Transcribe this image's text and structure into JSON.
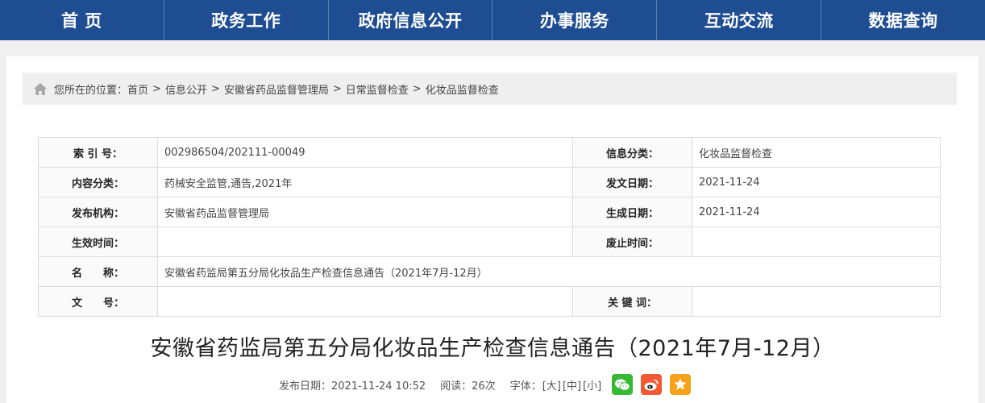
{
  "nav": {
    "items": [
      "首 页",
      "政务工作",
      "政府信息公开",
      "办事服务",
      "互动交流",
      "数据查询"
    ]
  },
  "breadcrumb": {
    "prefix": "您所在的位置：",
    "items": [
      "首页",
      "信息公开",
      "安徽省药品监督管理局",
      "日常监督检查",
      "化妆品监督检查"
    ],
    "separator": ">"
  },
  "meta": {
    "index_label": "索 引 号：",
    "index_value": "002986504/202111-00049",
    "category_label": "信息分类：",
    "category_value": "化妆品监督检查",
    "content_label": "内容分类：",
    "content_value": "药械安全监管,通告,2021年",
    "issue_date_label": "发文日期：",
    "issue_date_value": "2021-11-24",
    "org_label": "发布机构：",
    "org_value": "安徽省药品监督管理局",
    "gen_date_label": "生成日期：",
    "gen_date_value": "2021-11-24",
    "effective_label": "生效时间：",
    "effective_value": "",
    "abolish_label": "废止时间：",
    "abolish_value": "",
    "name_label": "名　　称：",
    "name_value": "安徽省药监局第五分局化妆品生产检查信息通告（2021年7月-12月）",
    "doc_no_label": "文　　号：",
    "doc_no_value": "",
    "keywords_label": "关 键 词：",
    "keywords_value": ""
  },
  "article": {
    "title": "安徽省药监局第五分局化妆品生产检查信息通告（2021年7月-12月）",
    "publish_prefix": "发布日期：2021-11-24 10:52",
    "reads": "阅读：26次",
    "font_label": "字体：",
    "font_large": "[大]",
    "font_medium": "[中]",
    "font_small": "[小]"
  },
  "icons": {
    "home": "home-icon",
    "wechat": "wechat-icon",
    "weibo": "weibo-icon",
    "favorite": "star-icon"
  },
  "colors": {
    "nav_bg": "#1e4d92",
    "wechat": "#37b934",
    "weibo": "#f15a32",
    "favorite": "#f7a21b"
  }
}
